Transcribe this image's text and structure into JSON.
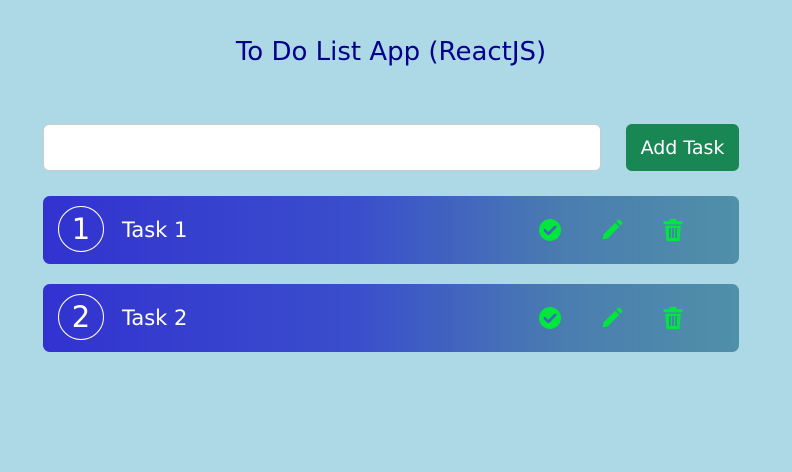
{
  "app": {
    "title": "To Do List App (ReactJS)"
  },
  "new_task": {
    "value": "",
    "placeholder": "",
    "add_label": "Add Task"
  },
  "tasks": [
    {
      "number": "1",
      "text": "Task 1"
    },
    {
      "number": "2",
      "text": "Task 2"
    }
  ],
  "icons": {
    "done": "check-circle-icon",
    "edit": "pencil-icon",
    "delete": "trash-icon"
  },
  "colors": {
    "background": "#add8e6",
    "title": "#00008b",
    "add_button": "#198754",
    "task_gradient_start": "#3232d0",
    "task_gradient_end": "#5090a8",
    "action_icon": "#00e63c"
  }
}
